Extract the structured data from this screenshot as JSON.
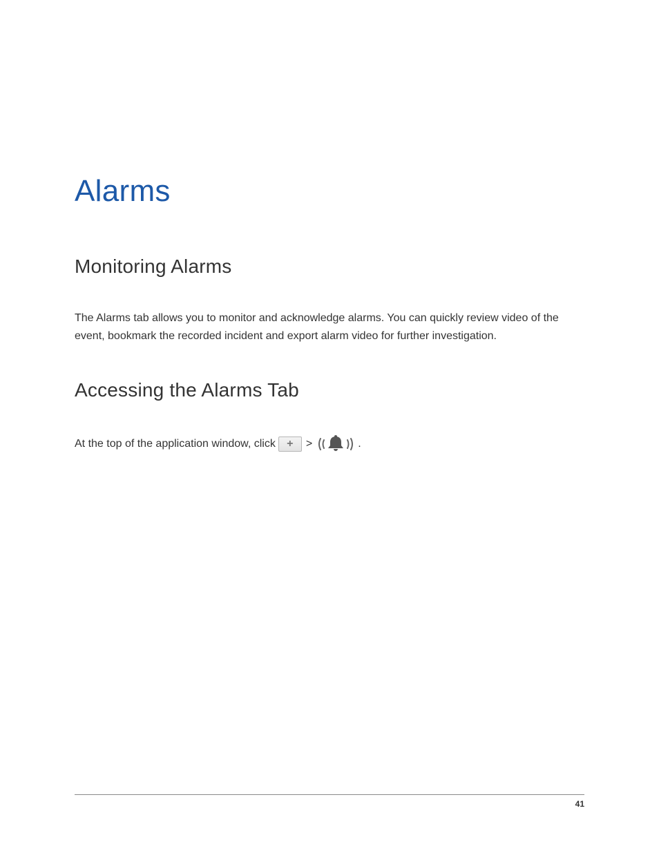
{
  "title": "Alarms",
  "sections": {
    "monitoring": {
      "heading": "Monitoring Alarms",
      "body": "The Alarms tab allows you to monitor and acknowledge alarms. You can quickly review video of the event, bookmark the recorded incident and export alarm video for further investigation."
    },
    "accessing": {
      "heading": "Accessing the Alarms Tab",
      "lead": "At the top of the application window, click",
      "separator": ">",
      "trail": "."
    }
  },
  "footer": {
    "page_number": "41"
  },
  "colors": {
    "title": "#1d59a8"
  }
}
